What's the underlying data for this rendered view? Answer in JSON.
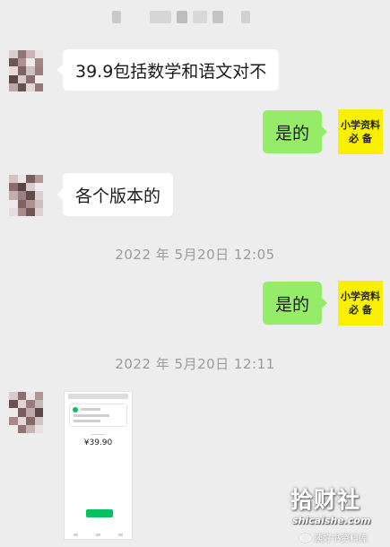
{
  "chat": {
    "messages": [
      {
        "text": "39.9包括数学和语文对不"
      },
      {
        "text": "是的"
      },
      {
        "text": "各个版本的"
      },
      {
        "text": "是的"
      }
    ],
    "timestamps": [
      "2022 年 5月20日 12:05",
      "2022 年 5月20日 12:11"
    ],
    "self_avatar_text": {
      "line1": "小学资料",
      "line2": "必 备"
    },
    "payment_screenshot": {
      "amount": "¥39.90"
    }
  },
  "watermark": {
    "logo": "拾财社",
    "domain": "shicaishe.com",
    "channel": "读好书资料库"
  },
  "colors": {
    "background": "#ededed",
    "incoming_bubble": "#ffffff",
    "outgoing_bubble": "#95ec69",
    "self_avatar": "#f8f000",
    "timestamp_text": "#9b9b9b",
    "wechat_green": "#07c160"
  }
}
